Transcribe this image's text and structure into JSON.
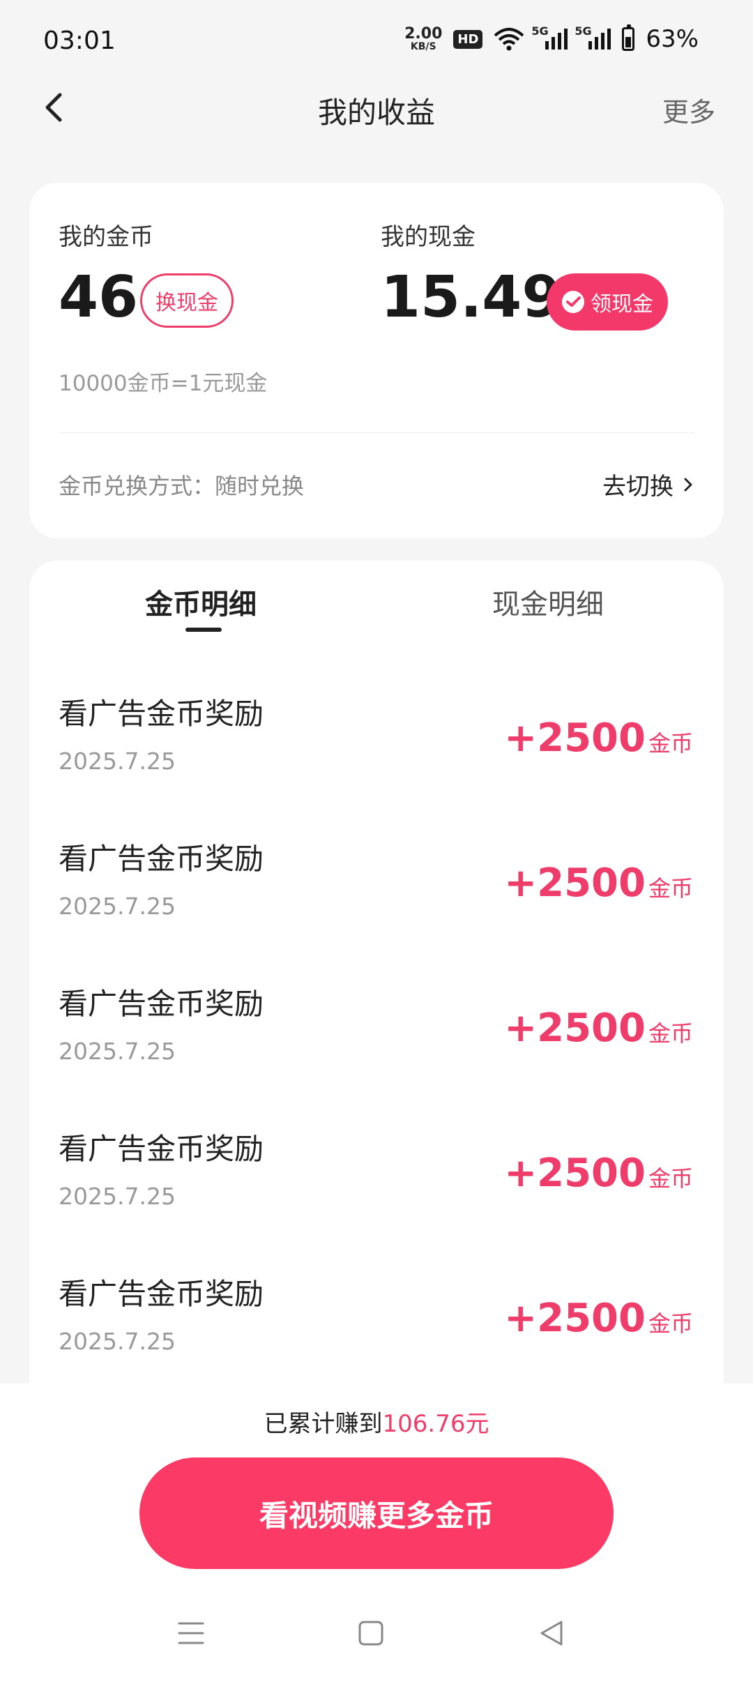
{
  "status": {
    "time": "03:01",
    "net_speed_value": "2.00",
    "net_speed_unit": "KB/S",
    "hd_label": "HD",
    "sig1_label": "5G",
    "sig2_label": "5G",
    "battery": "63%"
  },
  "nav": {
    "title": "我的收益",
    "more": "更多"
  },
  "summary": {
    "coins_label": "我的金币",
    "coins_value": "46",
    "exchange_button": "换现金",
    "cash_label": "我的现金",
    "cash_value": "15.49",
    "claim_button": "领现金",
    "rate_text": "10000金币=1元现金",
    "method_text": "金币兑换方式：随时兑换",
    "switch_text": "去切换"
  },
  "tabs": {
    "coin": "金币明细",
    "cash": "现金明细"
  },
  "records": [
    {
      "title": "看广告金币奖励",
      "date": "2025.7.25",
      "amount": "+2500",
      "unit": "金币"
    },
    {
      "title": "看广告金币奖励",
      "date": "2025.7.25",
      "amount": "+2500",
      "unit": "金币"
    },
    {
      "title": "看广告金币奖励",
      "date": "2025.7.25",
      "amount": "+2500",
      "unit": "金币"
    },
    {
      "title": "看广告金币奖励",
      "date": "2025.7.25",
      "amount": "+2500",
      "unit": "金币"
    },
    {
      "title": "看广告金币奖励",
      "date": "2025.7.25",
      "amount": "+2500",
      "unit": "金币"
    }
  ],
  "footer": {
    "total_prefix": "已累计赚到",
    "total_amount": "106.76元",
    "main_button": "看视频赚更多金币"
  },
  "colors": {
    "accent": "#ee3d6a",
    "button": "#fb3a66",
    "background": "#f5f5f5"
  }
}
